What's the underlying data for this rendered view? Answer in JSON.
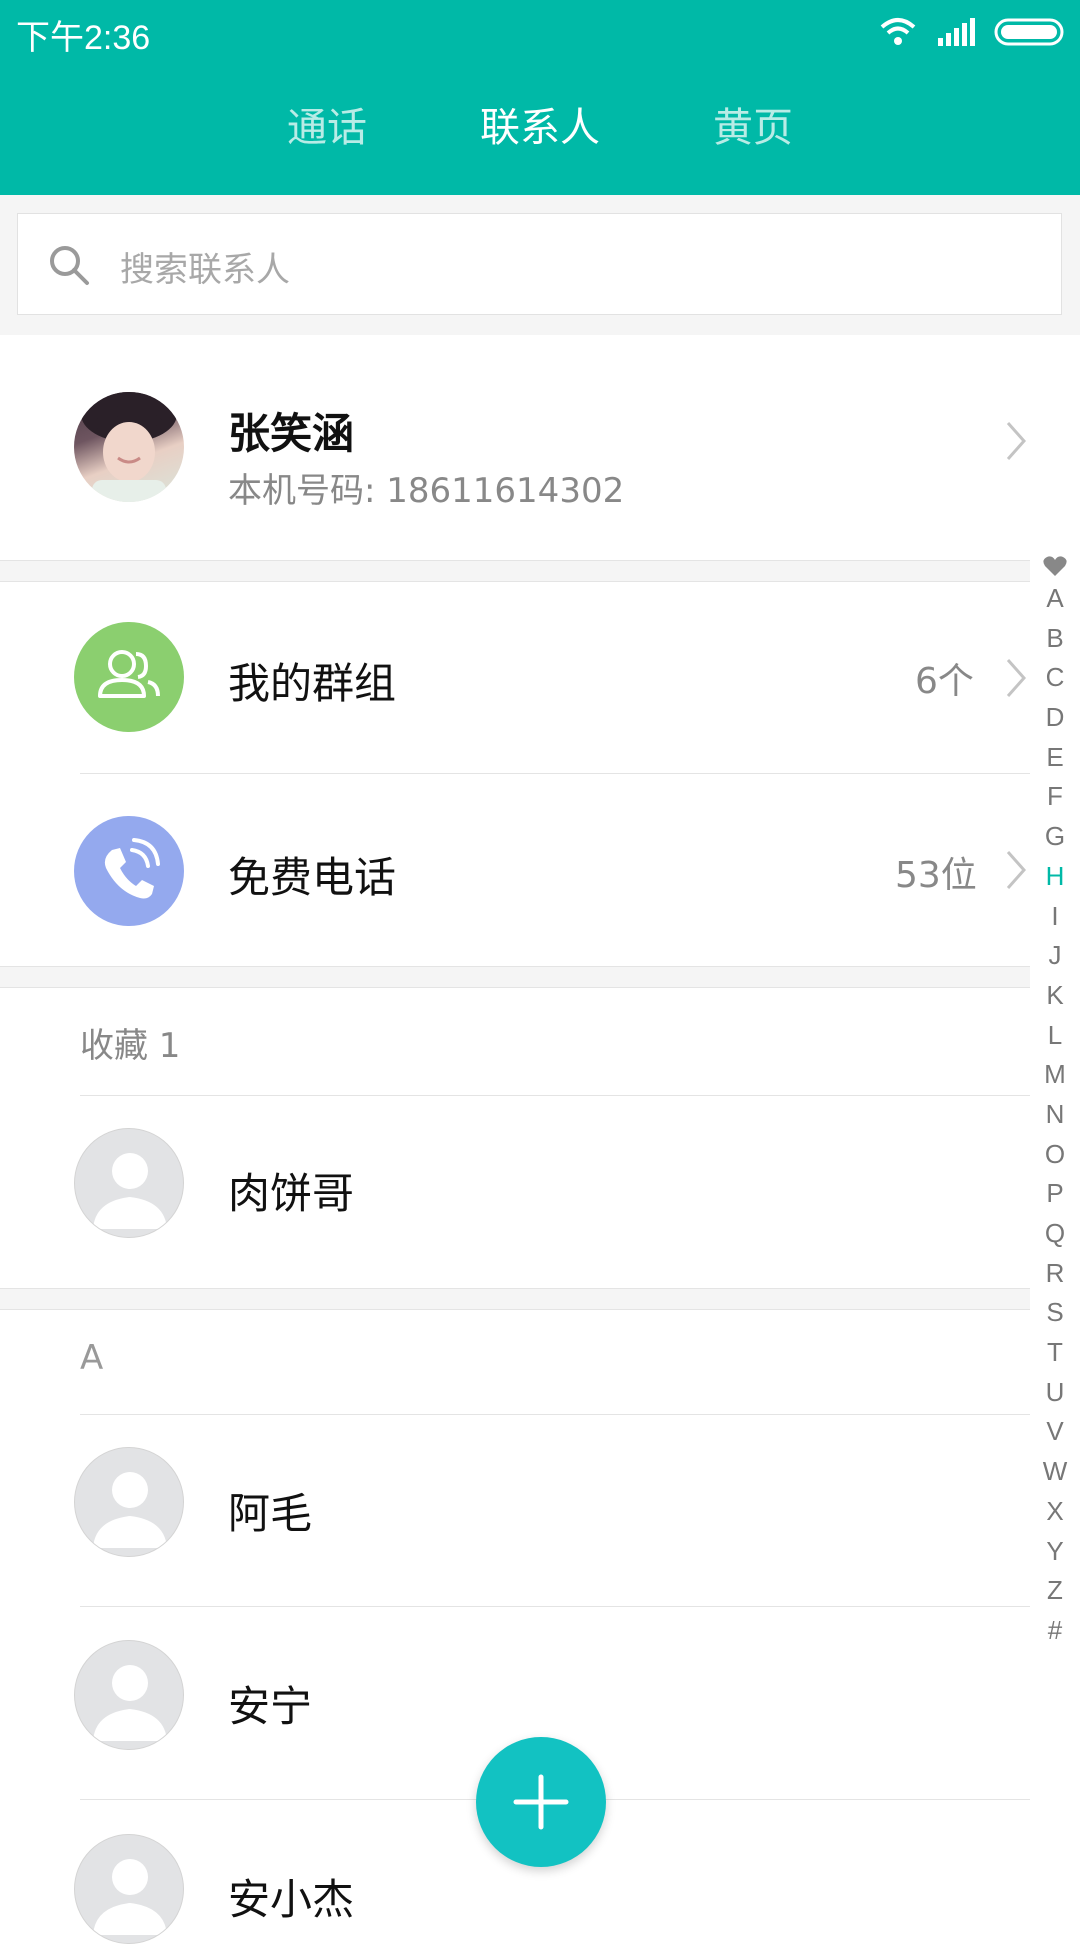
{
  "status_bar": {
    "time": "下午2:36",
    "icons": [
      "wifi-icon",
      "signal-icon",
      "battery-icon"
    ]
  },
  "tabs": [
    {
      "label": "通话",
      "active": false
    },
    {
      "label": "联系人",
      "active": true
    },
    {
      "label": "黄页",
      "active": false
    }
  ],
  "search": {
    "placeholder": "搜索联系人"
  },
  "me": {
    "name": "张笑涵",
    "number_label": "本机号码: 18611614302"
  },
  "entries": [
    {
      "label": "我的群组",
      "count": "6个",
      "icon": "group-icon",
      "color": "#8bcf6f"
    },
    {
      "label": "免费电话",
      "count": "53位",
      "icon": "phone-icon",
      "color": "#94a9ee"
    }
  ],
  "favorites": {
    "label": "收藏 1",
    "contacts": [
      "肉饼哥"
    ]
  },
  "section_a": {
    "label": "A",
    "contacts": [
      "阿毛",
      "安宁",
      "安小杰"
    ]
  },
  "index_letters": [
    "A",
    "B",
    "C",
    "D",
    "E",
    "F",
    "G",
    "H",
    "I",
    "J",
    "K",
    "L",
    "M",
    "N",
    "O",
    "P",
    "Q",
    "R",
    "S",
    "T",
    "U",
    "V",
    "W",
    "X",
    "Y",
    "Z",
    "#"
  ],
  "index_active": "H",
  "colors": {
    "accent": "#00b9a7",
    "fab": "#12c2c2"
  }
}
